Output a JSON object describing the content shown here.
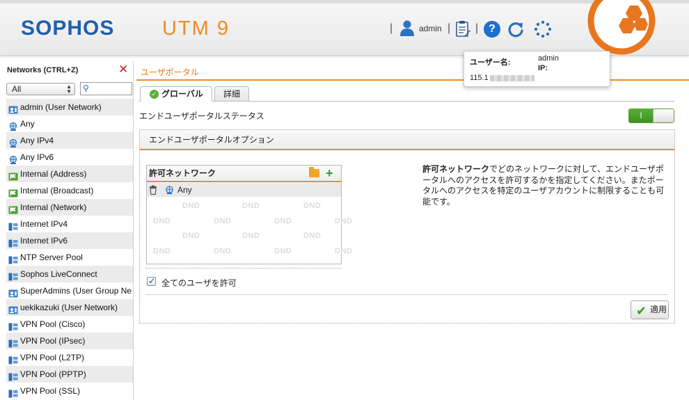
{
  "header": {
    "brand": "SOPHOS",
    "product": "UTM 9",
    "user": "admin",
    "separator": "|"
  },
  "tooltip": {
    "username_label": "ユーザー名:",
    "username_value": "admin",
    "ip_label": "IP:",
    "ip_value": "115.1"
  },
  "sidebar": {
    "title": "Networks (CTRL+Z)",
    "filter_value": "All",
    "items": [
      {
        "label": "admin (User Network)",
        "icon": "user-network-icon"
      },
      {
        "label": "Any",
        "icon": "any-network-icon"
      },
      {
        "label": "Any IPv4",
        "icon": "any-network-icon"
      },
      {
        "label": "Any IPv6",
        "icon": "any-network-icon"
      },
      {
        "label": "Internal (Address)",
        "icon": "interface-network-icon"
      },
      {
        "label": "Internal (Broadcast)",
        "icon": "interface-network-icon"
      },
      {
        "label": "Internal (Network)",
        "icon": "interface-network-icon"
      },
      {
        "label": "Internet IPv4",
        "icon": "network-icon"
      },
      {
        "label": "Internet IPv6",
        "icon": "network-icon"
      },
      {
        "label": "NTP Server Pool",
        "icon": "network-icon"
      },
      {
        "label": "Sophos LiveConnect",
        "icon": "network-icon"
      },
      {
        "label": "SuperAdmins (User Group Ne",
        "icon": "user-network-icon"
      },
      {
        "label": "uekikazuki (User Network)",
        "icon": "user-network-icon"
      },
      {
        "label": "VPN Pool (Cisco)",
        "icon": "network-icon"
      },
      {
        "label": "VPN Pool (IPsec)",
        "icon": "network-icon"
      },
      {
        "label": "VPN Pool (L2TP)",
        "icon": "network-icon"
      },
      {
        "label": "VPN Pool (PPTP)",
        "icon": "network-icon"
      },
      {
        "label": "VPN Pool (SSL)",
        "icon": "network-icon"
      }
    ]
  },
  "main": {
    "title": "ユーザポータル",
    "tabs": [
      {
        "label": "グローバル",
        "active": true
      },
      {
        "label": "詳細",
        "active": false
      }
    ],
    "status_label": "エンドユーザポータルステータス",
    "status_toggle": "on",
    "panel_title": "エンドユーザポータルオプション",
    "allowed_networks": {
      "title": "許可ネットワーク",
      "items": [
        "Any"
      ],
      "dnd_text": "DND"
    },
    "all_users_label": "全てのユーザを許可",
    "all_users_checked": true,
    "apply_label": "適用",
    "description_bold": "許可ネットワーク",
    "description_rest": "でどのネットワークに対して、エンドユーザポータルへのアクセスを許可するかを指定してください。またポータルへのアクセスを特定のユーザアカウントに制限することも可能です。"
  },
  "colors": {
    "brand_blue": "#1f5fae",
    "accent_orange": "#f08a24",
    "toggle_green": "#4aa22c"
  }
}
